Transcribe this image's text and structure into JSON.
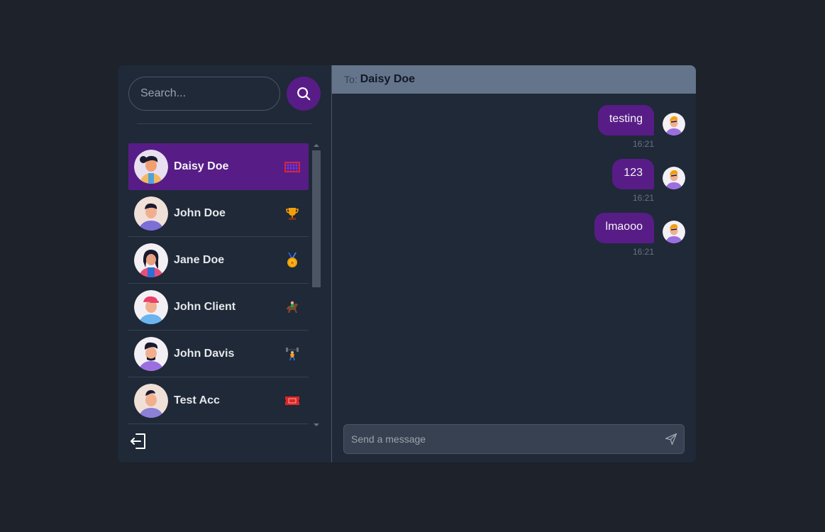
{
  "search": {
    "placeholder": "Search...",
    "button_icon": "search-icon"
  },
  "contacts": [
    {
      "name": "Daisy Doe",
      "badge_icon": "soccer-goal-icon",
      "active": true
    },
    {
      "name": "John Doe",
      "badge_icon": "trophy-icon",
      "active": false
    },
    {
      "name": "Jane Doe",
      "badge_icon": "medal-icon",
      "active": false
    },
    {
      "name": "John Client",
      "badge_icon": "horse-racing-icon",
      "active": false
    },
    {
      "name": "John Davis",
      "badge_icon": "weightlifter-icon",
      "active": false
    },
    {
      "name": "Test Acc",
      "badge_icon": "ticket-icon",
      "active": false
    }
  ],
  "chat": {
    "to_label": "To:",
    "to_name": "Daisy Doe",
    "messages": [
      {
        "text": "testing",
        "time": "16:21"
      },
      {
        "text": "123",
        "time": "16:21"
      },
      {
        "text": "lmaooo",
        "time": "16:21"
      }
    ],
    "input_placeholder": "Send a message"
  },
  "sidebar": {
    "logout_icon": "logout-icon"
  },
  "colors": {
    "background": "#1d222b",
    "panel": "#1f2937",
    "accent": "#581c87",
    "header": "#64748b"
  }
}
